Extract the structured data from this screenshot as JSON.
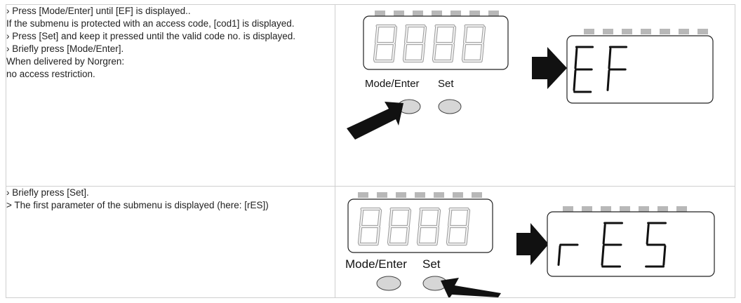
{
  "step1": {
    "lines": [
      "› Press [Mode/Enter] until [EF] is displayed..",
      "If the submenu is protected with an access code, [cod1] is displayed.",
      "› Press [Set] and keep it pressed until the valid code no. is displayed.",
      "› Briefly press [Mode/Enter].",
      "When delivered by Norgren:",
      "no access restriction."
    ],
    "labels": {
      "mode_enter": "Mode/Enter",
      "set": "Set"
    },
    "display_after": "EF"
  },
  "step2": {
    "lines": [
      "› Briefly press [Set].",
      "> The first parameter of the submenu is displayed (here: [rES])"
    ],
    "labels": {
      "mode_enter": "Mode/Enter",
      "set": "Set"
    },
    "display_after": "rES"
  },
  "colors": {
    "segment_off": "#d4d4d4",
    "segment_on": "#111111",
    "led_off": "#b8b8b8",
    "button_fill": "#d6d6d6",
    "arrow": "#111111"
  }
}
